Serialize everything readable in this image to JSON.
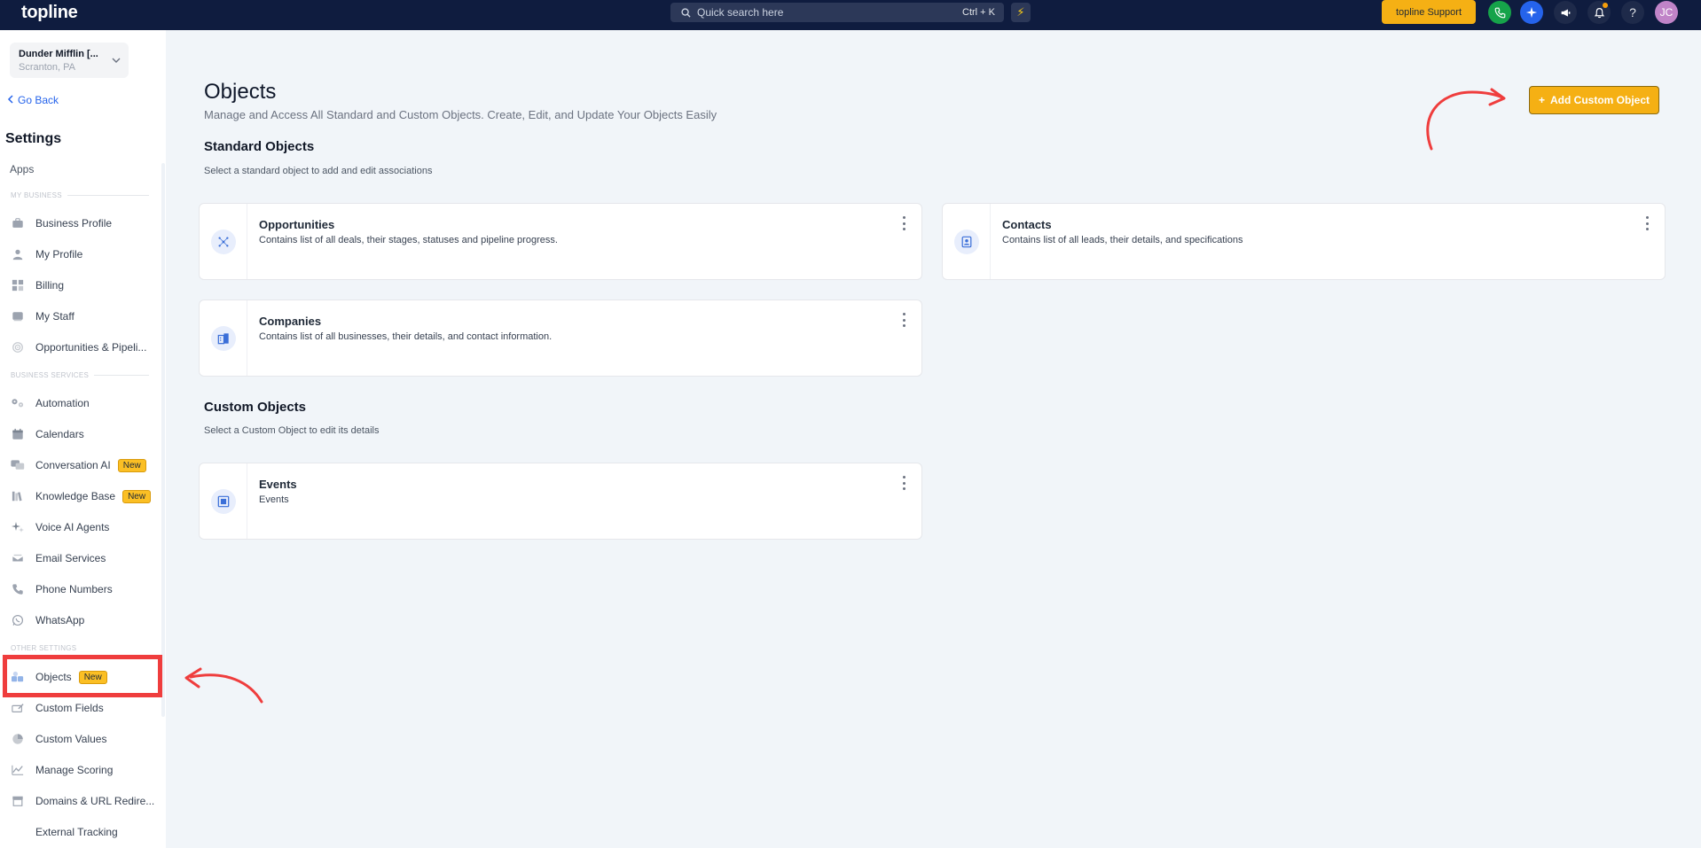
{
  "topbar": {
    "logo": "topline",
    "search_placeholder": "Quick search here",
    "search_shortcut": "Ctrl + K",
    "support_label": "topline Support",
    "avatar_initials": "JC",
    "help_label": "?"
  },
  "sidebar": {
    "account_name": "Dunder Mifflin [...",
    "account_location": "Scranton, PA",
    "go_back": "Go Back",
    "title": "Settings",
    "apps": "Apps",
    "section_my_business": "MY BUSINESS",
    "section_business_services": "BUSINESS SERVICES",
    "section_other_settings": "OTHER SETTINGS",
    "items": [
      {
        "label": "Business Profile"
      },
      {
        "label": "My Profile"
      },
      {
        "label": "Billing"
      },
      {
        "label": "My Staff"
      },
      {
        "label": "Opportunities & Pipeli..."
      },
      {
        "label": "Automation"
      },
      {
        "label": "Calendars"
      },
      {
        "label": "Conversation AI",
        "badge": "New"
      },
      {
        "label": "Knowledge Base",
        "badge": "New"
      },
      {
        "label": "Voice AI Agents"
      },
      {
        "label": "Email Services"
      },
      {
        "label": "Phone Numbers"
      },
      {
        "label": "WhatsApp"
      },
      {
        "label": "Objects",
        "badge": "New"
      },
      {
        "label": "Custom Fields"
      },
      {
        "label": "Custom Values"
      },
      {
        "label": "Manage Scoring"
      },
      {
        "label": "Domains & URL Redire..."
      },
      {
        "label": "External Tracking"
      }
    ]
  },
  "main": {
    "title": "Objects",
    "subtitle": "Manage and Access All Standard and Custom Objects. Create, Edit, and Update Your Objects Easily",
    "add_button": "Add Custom Object",
    "standard_title": "Standard Objects",
    "standard_sub": "Select a standard object to add and edit associations",
    "custom_title": "Custom Objects",
    "custom_sub": "Select a Custom Object to edit its details",
    "standard_objects": [
      {
        "title": "Opportunities",
        "desc": "Contains list of all deals, their stages, statuses and pipeline progress."
      },
      {
        "title": "Contacts",
        "desc": "Contains list of all leads, their details, and specifications"
      },
      {
        "title": "Companies",
        "desc": "Contains list of all businesses, their details, and contact information."
      }
    ],
    "custom_objects": [
      {
        "title": "Events",
        "desc": "Events"
      }
    ]
  },
  "colors": {
    "topbar": "#0f1c3f",
    "accent": "#f5b014",
    "link": "#2563eb",
    "highlight": "#ef3d3d"
  }
}
